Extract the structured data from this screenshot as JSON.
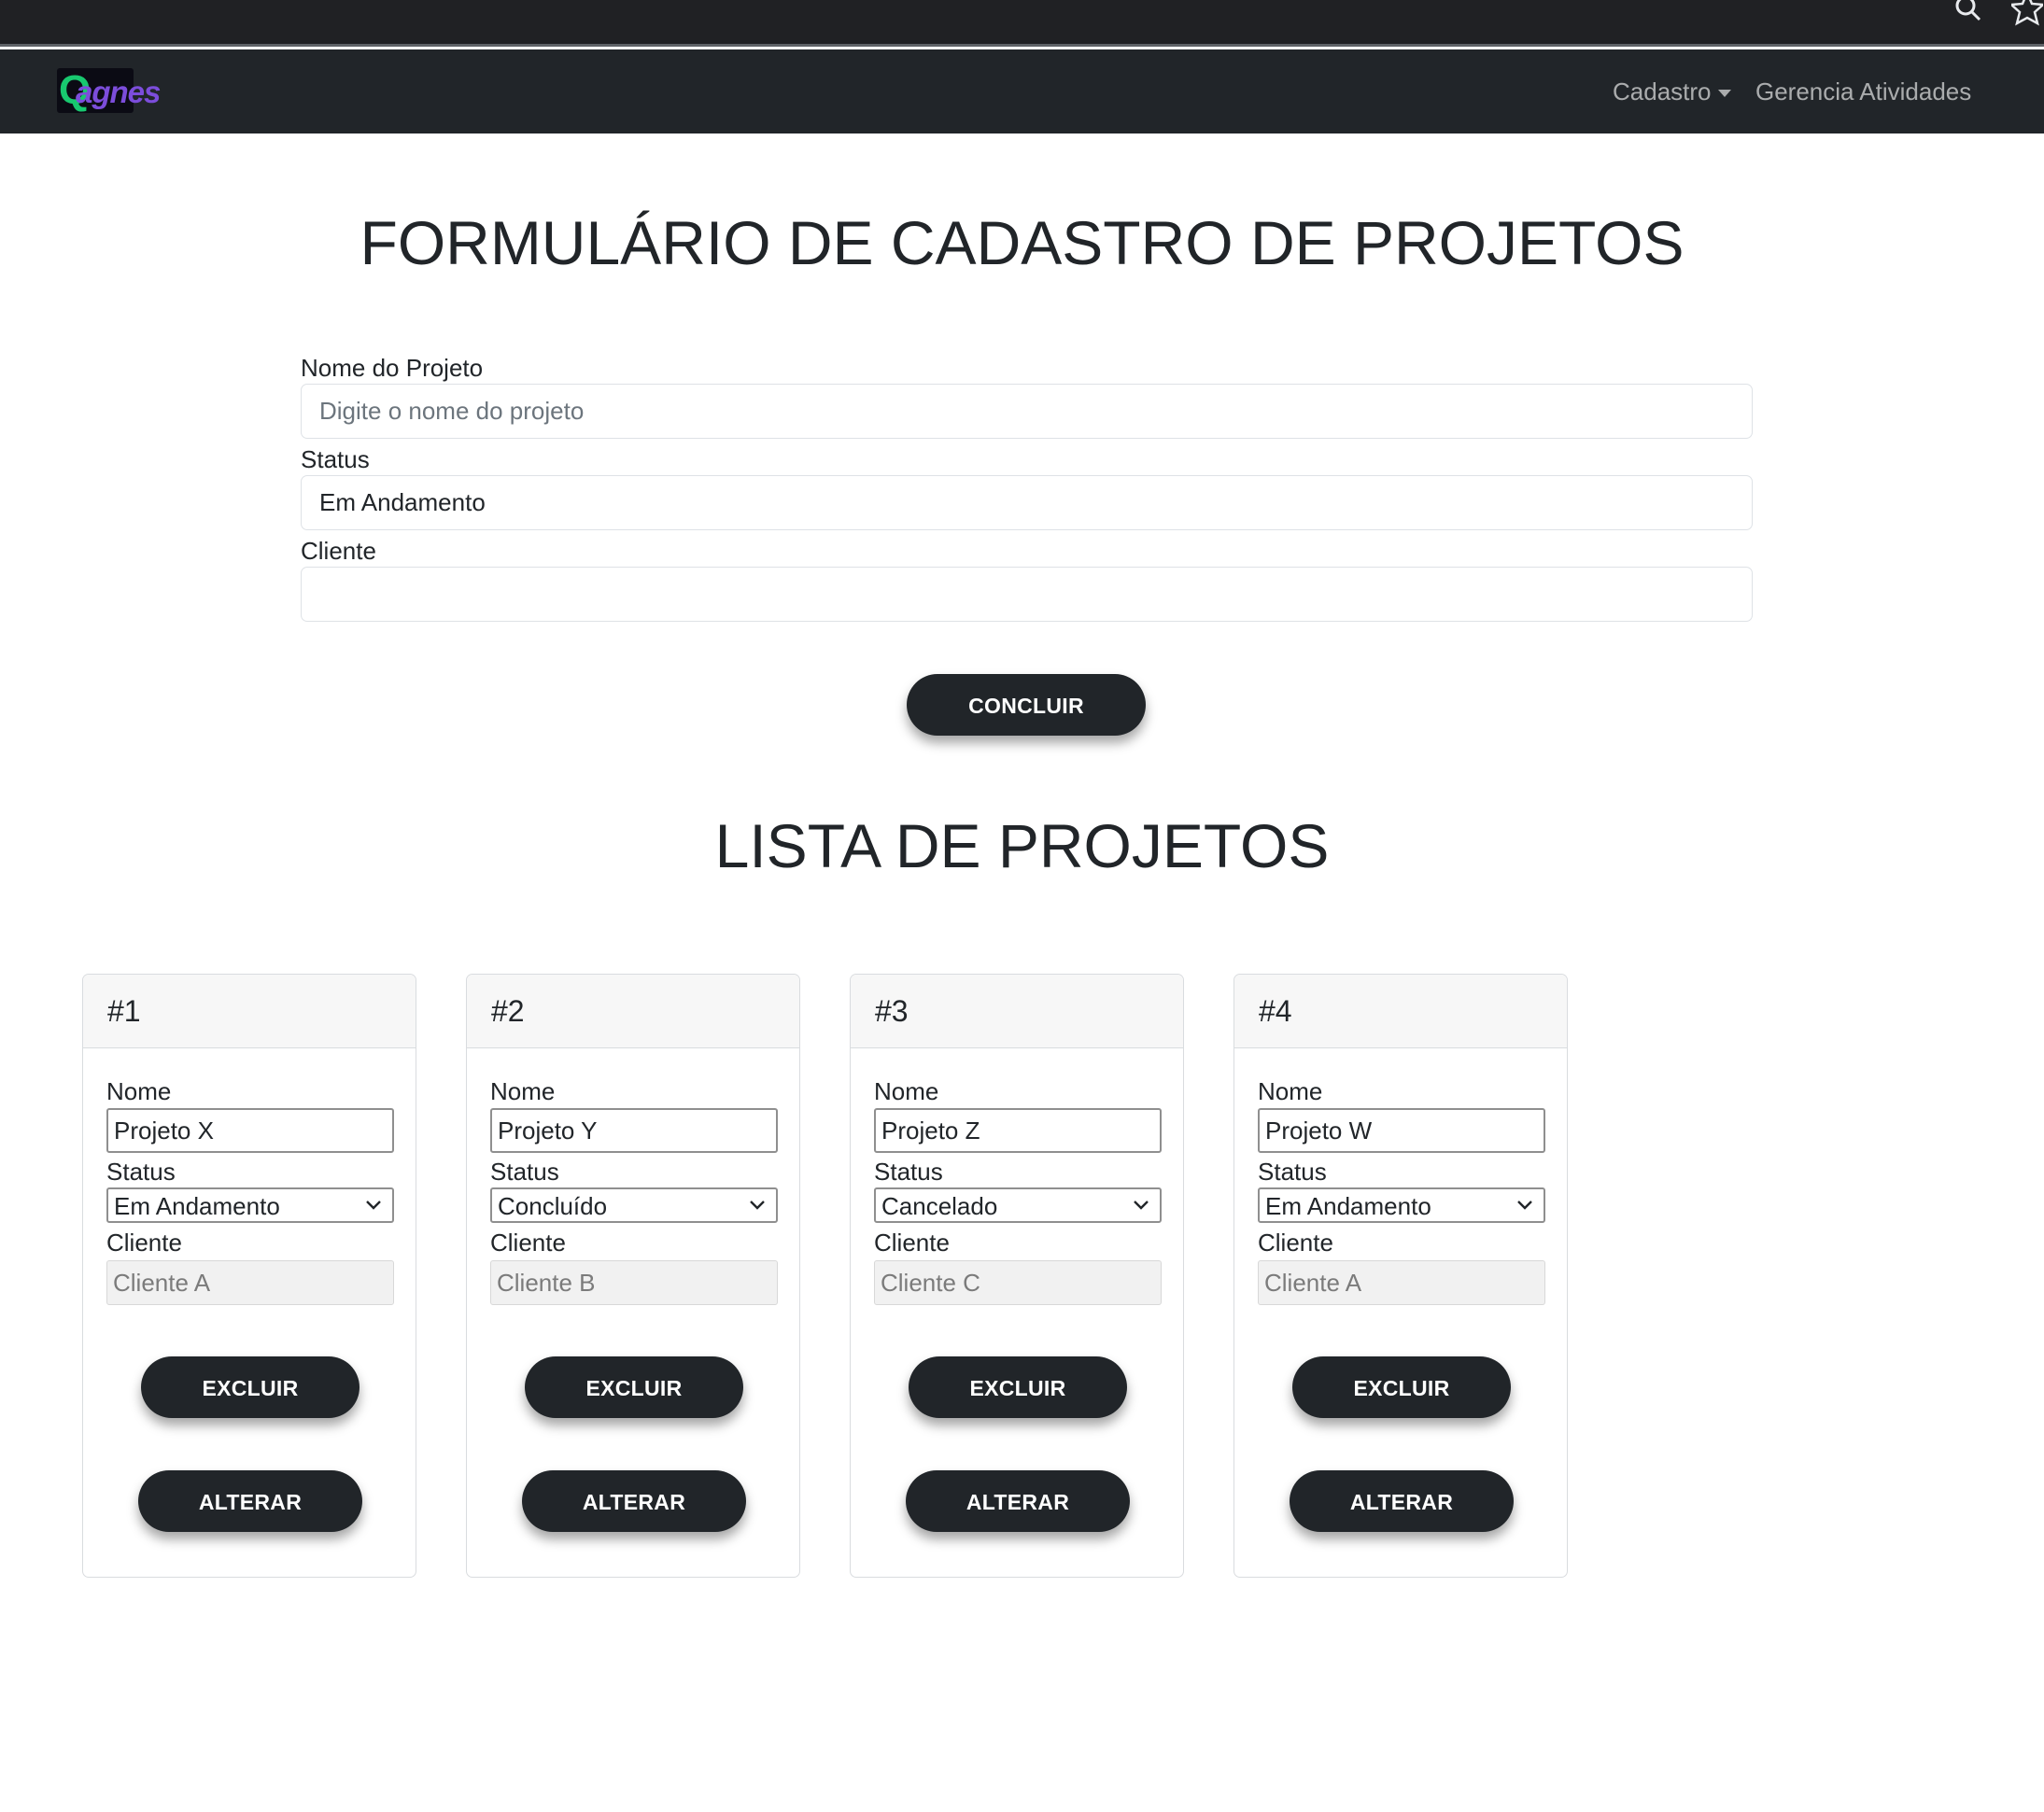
{
  "browser": {
    "icons": [
      "search-icon",
      "star-icon"
    ]
  },
  "navbar": {
    "logo_g": "Q",
    "logo_rest": "agnes",
    "items": [
      {
        "label": "Cadastro"
      },
      {
        "label": "Gerencia Atividades"
      }
    ]
  },
  "form": {
    "title": "FORMULÁRIO DE CADASTRO DE PROJETOS",
    "name_label": "Nome do Projeto",
    "name_placeholder": "Digite o nome do projeto",
    "name_value": "",
    "status_label": "Status",
    "status_value": "Em Andamento",
    "cliente_label": "Cliente",
    "cliente_value": "",
    "submit_label": "CONCLUIR"
  },
  "list": {
    "title": "LISTA DE PROJETOS",
    "field_labels": {
      "nome": "Nome",
      "status": "Status",
      "cliente": "Cliente"
    },
    "delete_label": "EXCLUIR",
    "edit_label": "ALTERAR",
    "projects": [
      {
        "number": "#1",
        "nome": "Projeto X",
        "status": "Em Andamento",
        "cliente": "Cliente A"
      },
      {
        "number": "#2",
        "nome": "Projeto Y",
        "status": "Concluído",
        "cliente": "Cliente B"
      },
      {
        "number": "#3",
        "nome": "Projeto Z",
        "status": "Cancelado",
        "cliente": "Cliente C"
      },
      {
        "number": "#4",
        "nome": "Projeto W",
        "status": "Em Andamento",
        "cliente": "Cliente A"
      }
    ]
  }
}
